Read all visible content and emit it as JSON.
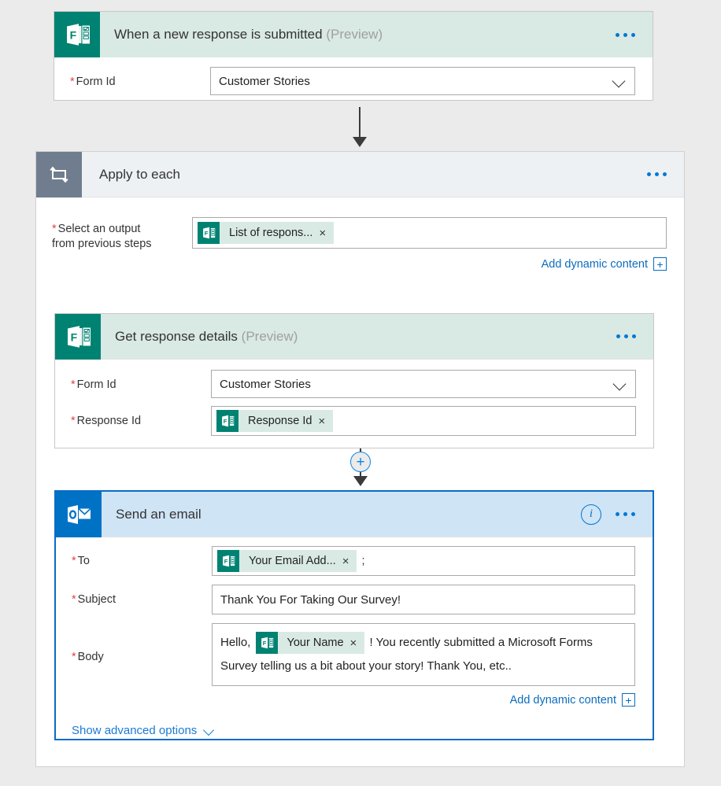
{
  "trigger": {
    "title": "When a new response is submitted",
    "preview": "(Preview)",
    "icon": "microsoft-forms-icon",
    "menu": "...",
    "fields": [
      {
        "label": "Form Id",
        "required": "*",
        "value": "Customer Stories",
        "control": "dropdown"
      }
    ]
  },
  "loop": {
    "title": "Apply to each",
    "icon": "loop-icon",
    "menu": "...",
    "field": {
      "label_line1": "Select an output",
      "label_line2": "from previous steps",
      "required": "*",
      "token": {
        "label": "List of respons...",
        "icon": "microsoft-forms-icon",
        "remove": "×"
      }
    },
    "add_dynamic_content": {
      "label": "Add dynamic content",
      "plus": "+"
    }
  },
  "get_response": {
    "title": "Get response details",
    "preview": "(Preview)",
    "icon": "microsoft-forms-icon",
    "menu": "...",
    "fields": [
      {
        "label": "Form Id",
        "required": "*",
        "value": "Customer Stories",
        "control": "dropdown"
      },
      {
        "label": "Response Id",
        "required": "*",
        "token": {
          "label": "Response Id",
          "icon": "microsoft-forms-icon",
          "remove": "×"
        }
      }
    ]
  },
  "send_email": {
    "title": "Send an email",
    "icon": "outlook-icon",
    "info": "i",
    "menu": "...",
    "to": {
      "label": "To",
      "required": "*",
      "token": {
        "label": "Your Email Add...",
        "icon": "microsoft-forms-icon",
        "remove": "×"
      },
      "trailing_text": ";"
    },
    "subject": {
      "label": "Subject",
      "required": "*",
      "value": "Thank You For Taking Our Survey!"
    },
    "body": {
      "label": "Body",
      "required": "*",
      "text_before": "Hello,",
      "token": {
        "label": "Your Name",
        "icon": "microsoft-forms-icon",
        "remove": "×"
      },
      "text_after": "! You recently submitted a Microsoft Forms Survey telling us a bit about your story! Thank You, etc.."
    },
    "add_dynamic_content": {
      "label": "Add dynamic content",
      "plus": "+"
    },
    "show_advanced": {
      "label": "Show advanced options",
      "chevron": "chevron-down-icon"
    }
  },
  "connectors": {
    "trigger_to_loop": "arrow-down",
    "response_to_email": "add-step-plus"
  },
  "colors": {
    "forms_green": "#008272",
    "forms_header": "#d9e9e4",
    "outlook_blue": "#0072c6",
    "outlook_header": "#cfe4f5",
    "loop_gray": "#6f7d8f",
    "link_blue": "#0b6cbf",
    "selection_blue": "#0a6cc4",
    "required_red": "#e04343",
    "canvas": "#ebebeb"
  }
}
